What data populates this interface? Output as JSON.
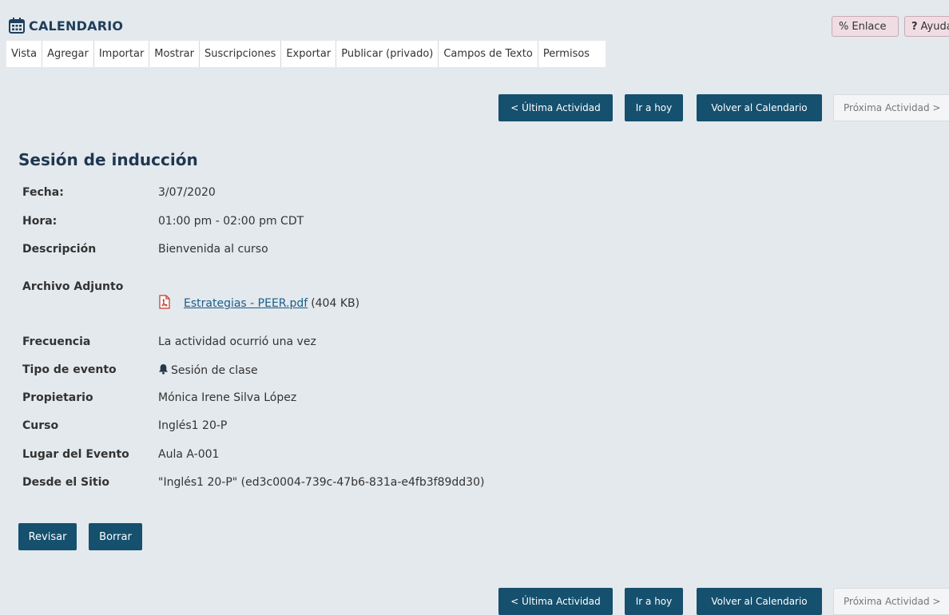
{
  "header": {
    "title": "CALENDARIO",
    "link_button": "Enlace",
    "help_button": "Ayuda"
  },
  "tabs": [
    "Vista",
    "Agregar",
    "Importar",
    "Mostrar",
    "Suscripciones",
    "Exportar",
    "Publicar (privado)",
    "Campos de Texto",
    "Permisos"
  ],
  "nav": {
    "prev": "< Última Actividad",
    "today": "Ir a hoy",
    "back": "Volver al Calendario",
    "next": "Próxima Actividad >"
  },
  "event": {
    "title": "Sesión de inducción",
    "fields": [
      {
        "label": "Fecha:",
        "value": "3/07/2020"
      },
      {
        "label": "Hora:",
        "value": "01:00 pm - 02:00 pm CDT"
      },
      {
        "label": "Descripción",
        "value": "Bienvenida al curso"
      },
      {
        "label": "Archivo Adjunto",
        "file_name": "Estrategias - PEER.pdf",
        "file_size": "(404 KB)"
      },
      {
        "label": "Frecuencia",
        "value": "La actividad ocurrió una vez"
      },
      {
        "label": "Tipo de evento",
        "value": "Sesión de clase"
      },
      {
        "label": "Propietario",
        "value": "Mónica Irene Silva López"
      },
      {
        "label": "Curso",
        "value": "Inglés1 20-P"
      },
      {
        "label": "Lugar del Evento",
        "value": "Aula A-001"
      },
      {
        "label": "Desde el Sitio",
        "value": "\"Inglés1 20-P\" (ed3c0004-739c-47b6-831a-e4fb3f89dd30)"
      }
    ]
  },
  "actions": {
    "edit": "Revisar",
    "delete": "Borrar"
  },
  "colors": {
    "primary_button": "#15506e",
    "title": "#1f3f5c",
    "link": "#1b5d8a"
  }
}
